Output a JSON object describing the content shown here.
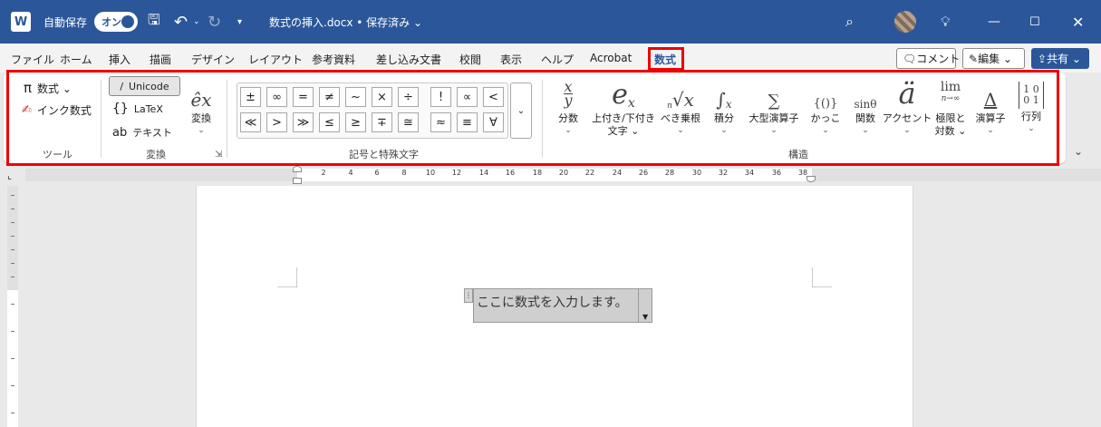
{
  "titlebar": {
    "app_icon": "W",
    "autosave_label": "自動保存",
    "autosave_toggle": "オン",
    "doc_title": "数式の挿入.docx • 保存済み ⌄",
    "icons": [
      "save-icon",
      "undo-icon",
      "redo-icon",
      "search-icon",
      "lightbulb-icon",
      "minimize-icon",
      "maximize-icon",
      "close-icon"
    ]
  },
  "tabs": [
    "ファイル",
    "ホーム",
    "挿入",
    "描画",
    "デザイン",
    "レイアウト",
    "参考資料",
    "差し込み文書",
    "校閲",
    "表示",
    "ヘルプ",
    "Acrobat",
    "数式"
  ],
  "active_tab": "数式",
  "right_buttons": {
    "comment": "コメント",
    "edit": "編集 ⌄",
    "share": "共有 ⌄"
  },
  "ribbon": {
    "tools": {
      "equation": "数式 ⌄",
      "ink_equation": "インク数式",
      "group_label": "ツール"
    },
    "conversions": {
      "unicode": "Unicode",
      "latex": "LaTeX",
      "text": "テキスト",
      "convert": "変換",
      "convert_chevron": "⌄",
      "group_label": "変換"
    },
    "symbols": {
      "row1": [
        "±",
        "∞",
        "=",
        "≠",
        "~",
        "×",
        "÷",
        "!",
        "∝",
        "<"
      ],
      "row2": [
        "≪",
        ">",
        "≫",
        "≤",
        "≥",
        "∓",
        "≅",
        "≈",
        "≡",
        "∀"
      ],
      "more": "⌄",
      "group_label": "記号と特殊文字"
    },
    "structures": {
      "items": [
        {
          "label": "分数",
          "glyph": "x⁄y"
        },
        {
          "label": "上付き/下付き\n文字 ⌄",
          "glyph": "eˣ"
        },
        {
          "label": "べき乗根",
          "glyph": "ⁿ√x"
        },
        {
          "label": "積分",
          "glyph": "∫"
        },
        {
          "label": "大型演算子",
          "glyph": "∑"
        },
        {
          "label": "かっこ",
          "glyph": "{()}"
        },
        {
          "label": "関数",
          "glyph": "sinθ"
        },
        {
          "label": "アクセント",
          "glyph": "ä"
        },
        {
          "label": "極限と\n対数 ⌄",
          "glyph": "lim"
        },
        {
          "label": "演算子",
          "glyph": "Δ"
        },
        {
          "label": "行列",
          "glyph": "[10;01]"
        }
      ],
      "chevron": "⌄",
      "group_label": "構造"
    }
  },
  "ruler": {
    "numbers": [
      "2",
      "4",
      "6",
      "8",
      "10",
      "12",
      "14",
      "16",
      "18",
      "20",
      "22",
      "24",
      "26",
      "28",
      "30",
      "32",
      "34",
      "36",
      "38"
    ]
  },
  "document": {
    "equation_placeholder": "ここに数式を入力します。"
  }
}
